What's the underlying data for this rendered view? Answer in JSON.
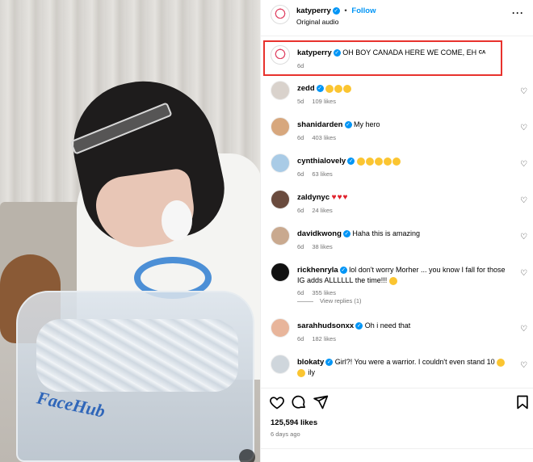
{
  "media": {
    "product_logo": "FaceHub"
  },
  "header": {
    "username": "katyperry",
    "verified": true,
    "separator": "•",
    "follow_label": "Follow",
    "audio": "Original audio",
    "more_icon": "more-horizontal-icon"
  },
  "caption": {
    "username": "katyperry",
    "text": "OH BOY CANADA HERE WE COME, EH",
    "flag": "CA",
    "age": "6d",
    "highlight_color": "#e8322d"
  },
  "comments": [
    {
      "username": "zedd",
      "text": "",
      "emojis": [
        "grin",
        "grin",
        "grin"
      ],
      "age": "5d",
      "likes": "109 likes"
    },
    {
      "username": "shanidarden",
      "text": "My hero",
      "emojis": [],
      "age": "6d",
      "likes": "403 likes"
    },
    {
      "username": "cynthialovely",
      "text": "",
      "emojis": [
        "grin",
        "grin",
        "grin",
        "grin",
        "grin"
      ],
      "age": "6d",
      "likes": "63 likes"
    },
    {
      "username": "zaldynyc",
      "text": "",
      "emojis": [
        "heart",
        "heart",
        "heart"
      ],
      "age": "6d",
      "likes": "24 likes"
    },
    {
      "username": "davidkwong",
      "text": "Haha this is amazing",
      "emojis": [],
      "age": "6d",
      "likes": "38 likes"
    },
    {
      "username": "rickhenryla",
      "text": "lol don't worry Morher ... you know I fall for those IG adds ALLLLLL the time!!!",
      "emojis": [
        "grin"
      ],
      "age": "6d",
      "likes": "355 likes"
    },
    {
      "username": "sarahhudsonxx",
      "text": "Oh i need that",
      "emojis": [],
      "age": "6d",
      "likes": "182 likes"
    },
    {
      "username": "blokaty",
      "text": "Girl?! You were a warrior. I couldn't even stand 10",
      "emojis": [
        "grin",
        "grin"
      ],
      "text_after": "ily",
      "age": "",
      "likes": ""
    }
  ],
  "view_replies_label": "View replies (1)",
  "actions": {
    "like_icon": "heart-outline-icon",
    "comment_icon": "comment-icon",
    "share_icon": "share-icon",
    "save_icon": "bookmark-icon"
  },
  "likes_count": "125,594 likes",
  "posted": "6 days ago",
  "colors": {
    "verified_blue": "#0095f6",
    "follow_blue": "#0095f6",
    "meta_gray": "#737373"
  }
}
